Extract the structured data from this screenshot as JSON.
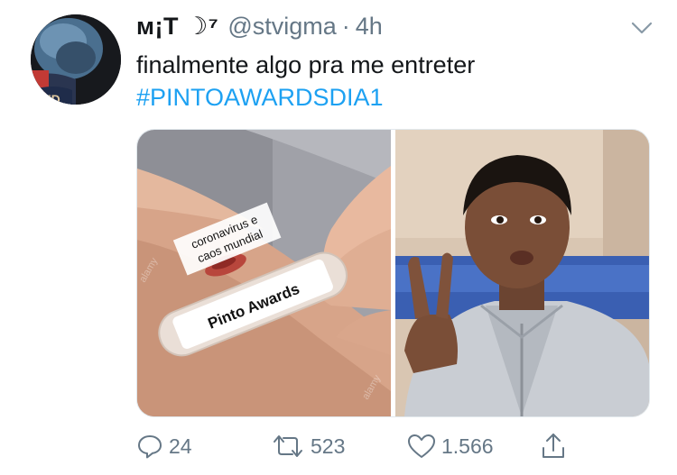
{
  "tweet": {
    "display_name": "ᴍ¡T ☽⁷",
    "handle": "@stvigma",
    "separator": "·",
    "time": "4h",
    "text": "finalmente algo pra me entreter",
    "hashtag": "#PINTOAWARDSDIA1",
    "avatar_text": "VED",
    "media": {
      "left_image": {
        "upper_label_line1": "coronavirus e",
        "upper_label_line2": "caos mundial",
        "bandage_label": "Pinto Awards",
        "watermark": "alamy"
      }
    },
    "actions": {
      "reply_count": "24",
      "retweet_count": "523",
      "like_count": "1.566"
    }
  },
  "colors": {
    "link": "#1da1f2",
    "secondary_text": "#657786",
    "primary_text": "#14171a"
  },
  "icons": [
    "chevron-down-icon",
    "reply-icon",
    "retweet-icon",
    "like-icon",
    "share-icon"
  ]
}
